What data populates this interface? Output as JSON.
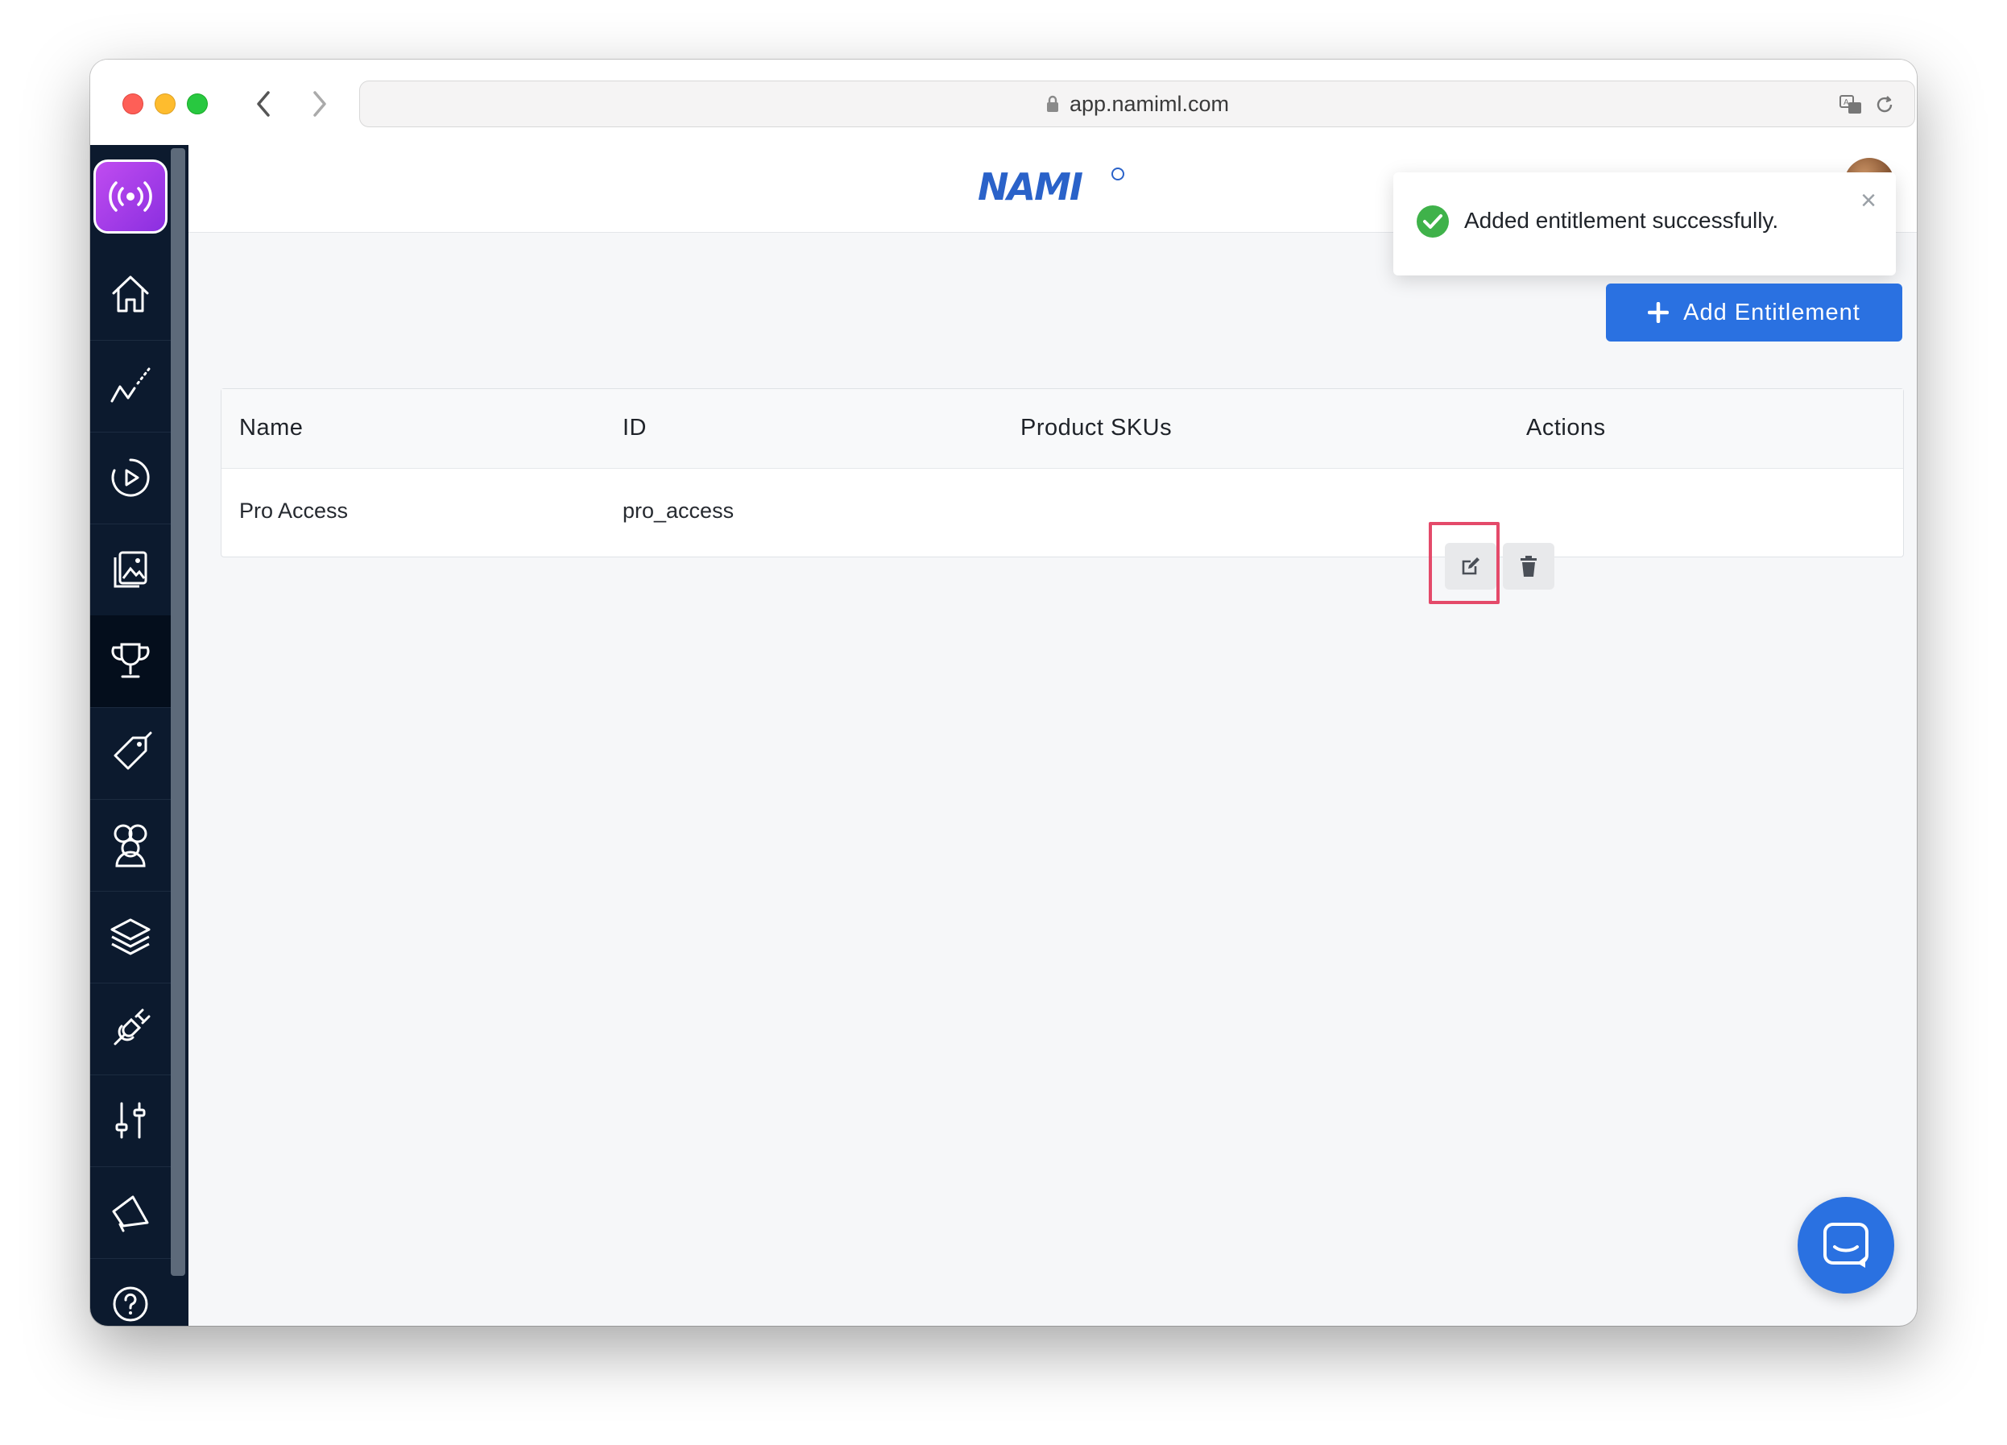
{
  "browser": {
    "url": "app.namiml.com"
  },
  "header": {
    "logo_text": "NAMI"
  },
  "sidebar": {
    "items": [
      {
        "icon": "home-icon"
      },
      {
        "icon": "analytics-icon"
      },
      {
        "icon": "campaign-play-icon"
      },
      {
        "icon": "paywalls-gallery-icon"
      },
      {
        "icon": "trophy-icon",
        "active": true
      },
      {
        "icon": "tag-icon"
      },
      {
        "icon": "users-icon"
      },
      {
        "icon": "layers-icon"
      },
      {
        "icon": "integrations-plug-icon"
      },
      {
        "icon": "settings-sliders-icon"
      },
      {
        "icon": "megaphone-icon"
      },
      {
        "icon": "help-icon"
      }
    ]
  },
  "toast": {
    "message": "Added entitlement successfully.",
    "close_label": "×"
  },
  "toolbar": {
    "add_label": "Add Entitlement"
  },
  "table": {
    "headers": [
      "Name",
      "ID",
      "Product SKUs",
      "Actions"
    ],
    "rows": [
      {
        "name": "Pro Access",
        "id": "pro_access",
        "skus": ""
      }
    ]
  },
  "colors": {
    "primary": "#2a71e1",
    "sidebar": "#0c1a2e",
    "success": "#3fb24a",
    "highlight": "#e44a6a"
  }
}
